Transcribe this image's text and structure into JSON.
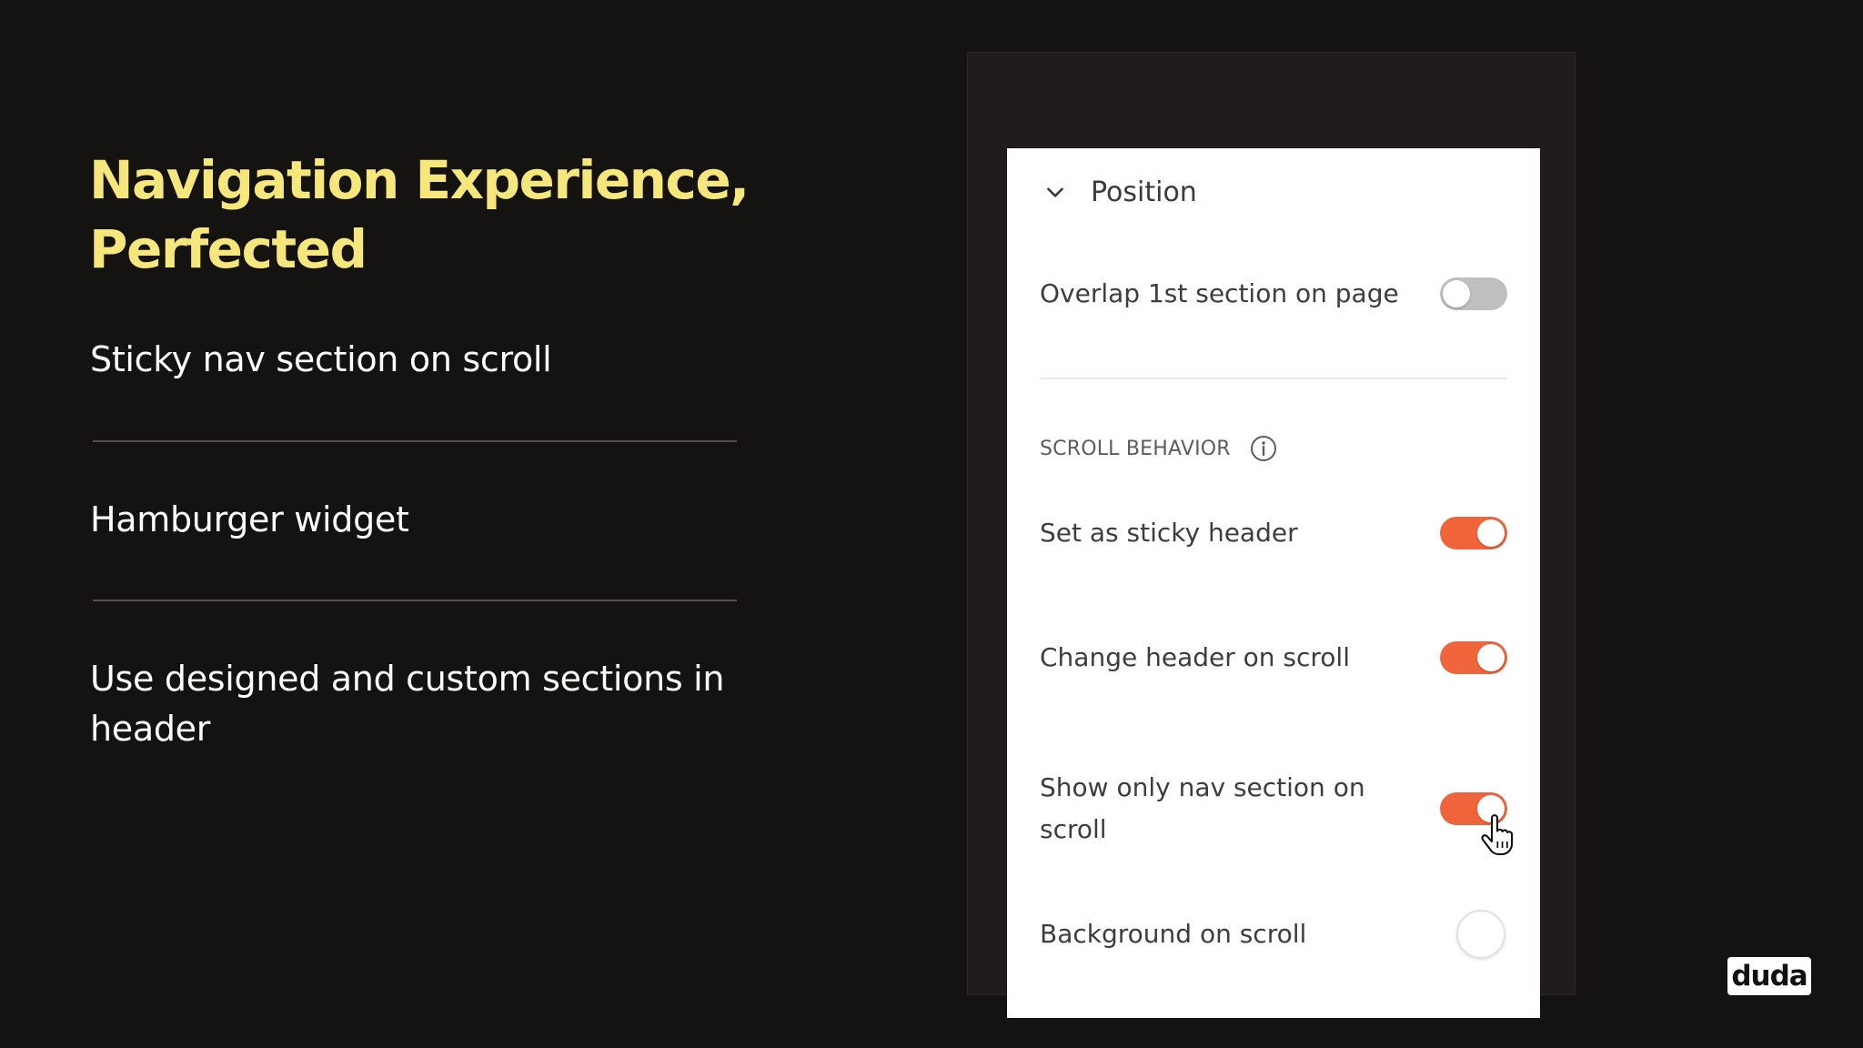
{
  "slide": {
    "headline_line1": "Navigation Experience,",
    "headline_line2": "Perfected",
    "features": [
      "Sticky nav section on scroll",
      "Hamburger widget",
      "Use designed and custom sections in header"
    ],
    "headline_color": "#f6e77c"
  },
  "panel": {
    "title": "Position",
    "overlap_label": "Overlap 1st section on page",
    "overlap_on": false,
    "section_label": "SCROLL BEHAVIOR",
    "sticky_label": "Set as sticky header",
    "sticky_on": true,
    "change_label": "Change header on scroll",
    "change_on": true,
    "shownav_label": "Show only nav section on scroll",
    "shownav_on": true,
    "background_label": "Background on scroll",
    "accent_color": "#f0643c"
  },
  "brand": {
    "logo_text": "duda"
  }
}
